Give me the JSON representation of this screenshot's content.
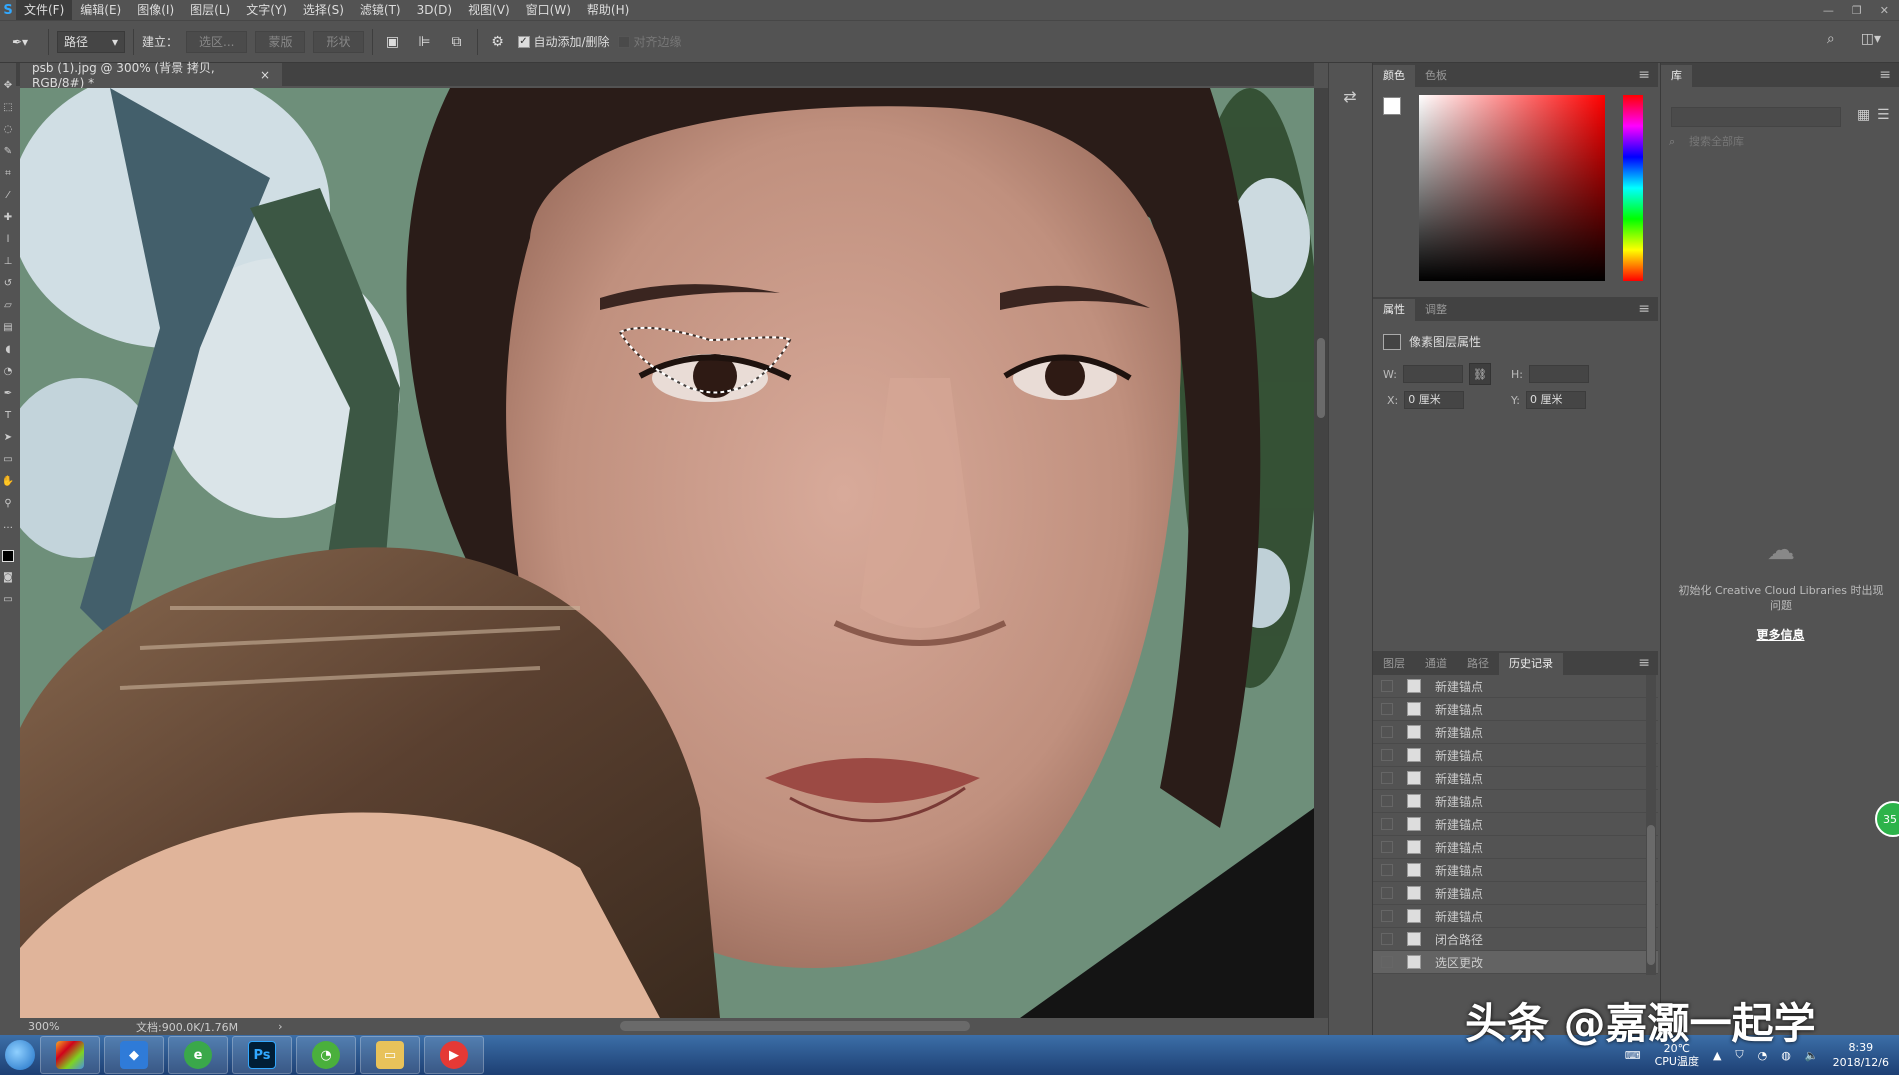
{
  "app": {
    "logo": "S"
  },
  "menu": {
    "items": [
      "文件(F)",
      "编辑(E)",
      "图像(I)",
      "图层(L)",
      "文字(Y)",
      "选择(S)",
      "滤镜(T)",
      "3D(D)",
      "视图(V)",
      "窗口(W)",
      "帮助(H)"
    ]
  },
  "options": {
    "mode_value": "路径",
    "build_label": "建立：",
    "selection_btn": "选区...",
    "mask_btn": "蒙版",
    "shape_btn": "形状",
    "auto_add_delete": "自动添加/删除",
    "auto_add_checked": true,
    "align_edges": "对齐边缘",
    "align_checked": false
  },
  "document": {
    "tab_title": "psb (1).jpg @ 300% (背景 拷贝, RGB/8#) *",
    "zoom": "300%",
    "doc_info": "文档:900.0K/1.76M"
  },
  "color_panel": {
    "tabs": [
      "颜色",
      "色板"
    ],
    "foreground": "#ffffff",
    "background": "#000000"
  },
  "properties_panel": {
    "tabs": [
      "属性",
      "调整"
    ],
    "title": "像素图层属性",
    "w_label": "W:",
    "h_label": "H:",
    "x_label": "X:",
    "y_label": "Y:",
    "x_value": "0 厘米",
    "y_value": "0 厘米"
  },
  "history_panel": {
    "tabs": [
      "图层",
      "通道",
      "路径",
      "历史记录"
    ],
    "items": [
      "新建锚点",
      "新建锚点",
      "新建锚点",
      "新建锚点",
      "新建锚点",
      "新建锚点",
      "新建锚点",
      "新建锚点",
      "新建锚点",
      "新建锚点",
      "新建锚点",
      "闭合路径",
      "选区更改"
    ]
  },
  "library_panel": {
    "tab": "库",
    "search_placeholder": "搜索全部库",
    "message": "初始化 Creative Cloud Libraries 时出现问题",
    "link": "更多信息",
    "badge": "35"
  },
  "taskbar": {
    "ps_label": "Ps",
    "temp": "20℃",
    "temp_label": "CPU温度",
    "time": "8:39",
    "date": "2018/12/6"
  },
  "watermark": "头条 @嘉灏一起学"
}
